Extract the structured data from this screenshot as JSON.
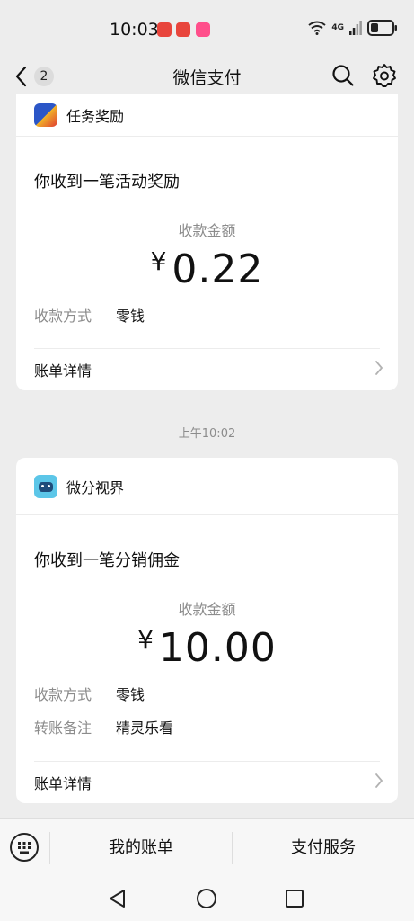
{
  "status_bar": {
    "time": "10:03",
    "network": "4G"
  },
  "nav": {
    "back_count": "2",
    "title": "微信支付"
  },
  "card1": {
    "source_name": "任务奖励",
    "message": "你收到一笔活动奖励",
    "amount_label": "收款金额",
    "currency": "¥",
    "amount": "0.22",
    "method_key": "收款方式",
    "method_value": "零钱",
    "detail_label": "账单详情"
  },
  "time_separator": "上午10:02",
  "card2": {
    "source_name": "微分视界",
    "message": "你收到一笔分销佣金",
    "amount_label": "收款金额",
    "currency": "¥",
    "amount": "10.00",
    "method_key": "收款方式",
    "method_value": "零钱",
    "note_key": "转账备注",
    "note_value": "精灵乐看",
    "detail_label": "账单详情"
  },
  "bottom_menu": {
    "item1": "我的账单",
    "item2": "支付服务"
  },
  "colors": {
    "page_bg": "#ededed",
    "card_bg": "#ffffff",
    "muted_text": "#8c8c8c"
  }
}
